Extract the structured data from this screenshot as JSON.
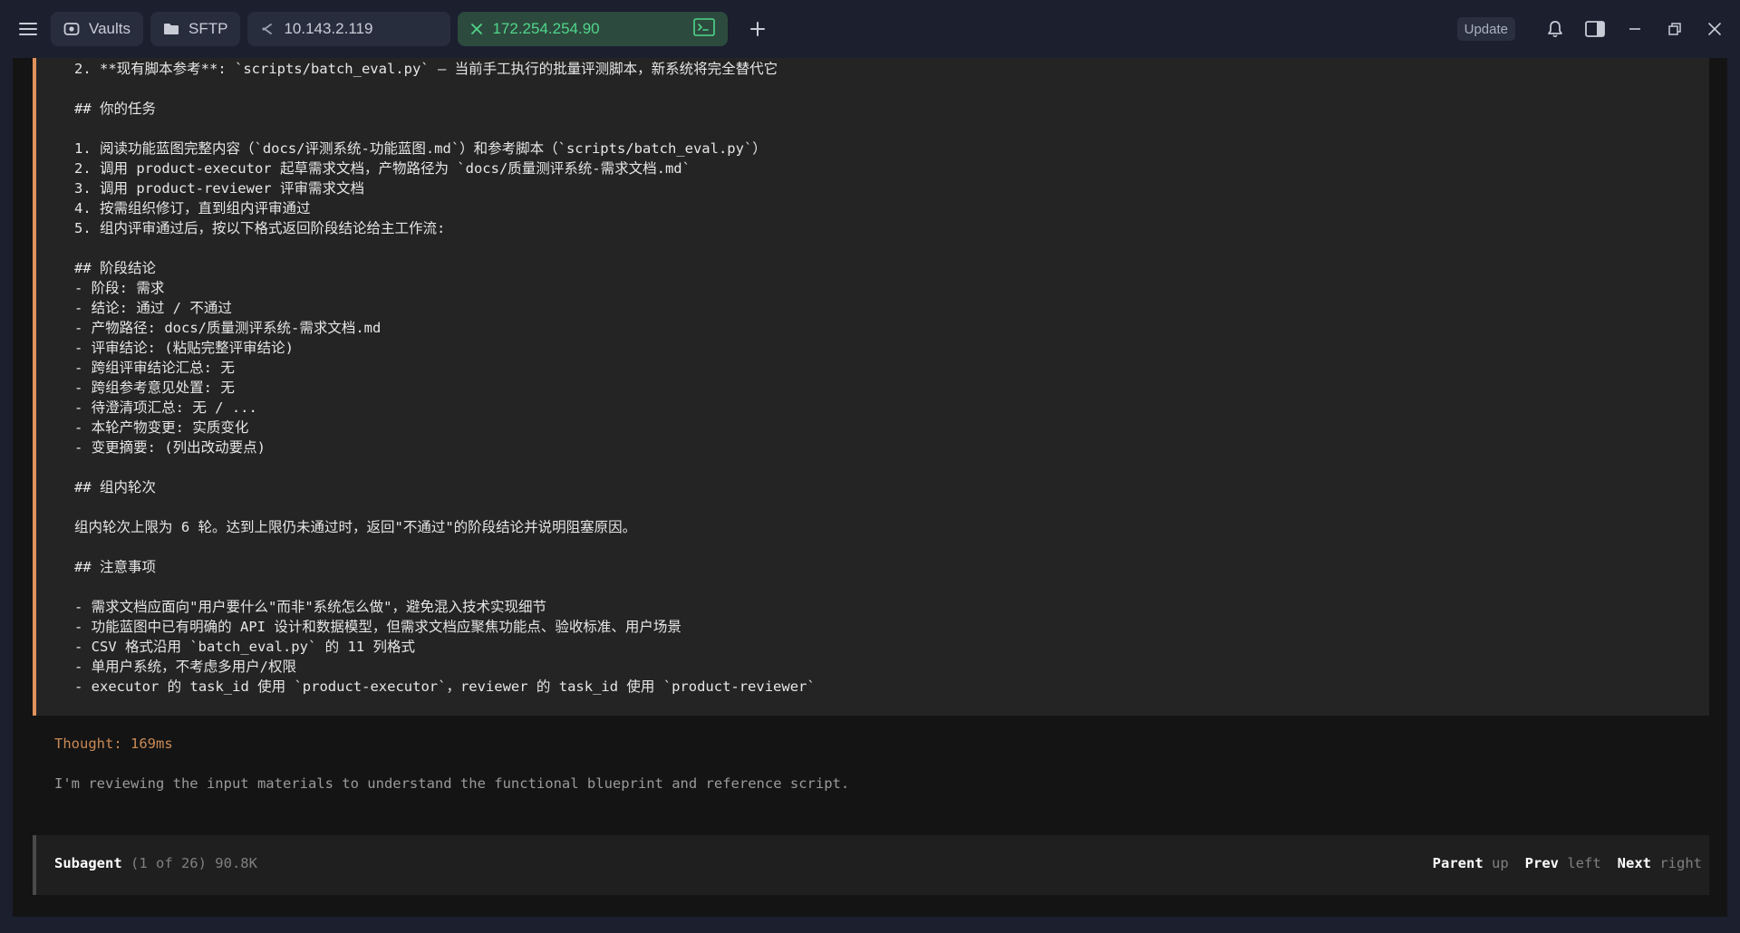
{
  "tabs": {
    "vaults_label": "Vaults",
    "sftp_label": "SFTP",
    "host_label": "10.143.2.119",
    "active_label": "172.254.254.90"
  },
  "toolbar": {
    "update_label": "Update"
  },
  "colors": {
    "accent_green": "#4fd68a",
    "quote_border": "#e0915a",
    "thought": "#c98a55"
  },
  "terminal": {
    "lines": [
      "2. **现有脚本参考**: `scripts/batch_eval.py` — 当前手工执行的批量评测脚本，新系统将完全替代它",
      "",
      "## 你的任务",
      "",
      "1. 阅读功能蓝图完整内容（`docs/评测系统-功能蓝图.md`）和参考脚本（`scripts/batch_eval.py`）",
      "2. 调用 product-executor 起草需求文档，产物路径为 `docs/质量测评系统-需求文档.md`",
      "3. 调用 product-reviewer 评审需求文档",
      "4. 按需组织修订，直到组内评审通过",
      "5. 组内评审通过后，按以下格式返回阶段结论给主工作流:",
      "",
      "## 阶段结论",
      "- 阶段: 需求",
      "- 结论: 通过 / 不通过",
      "- 产物路径: docs/质量测评系统-需求文档.md",
      "- 评审结论: (粘贴完整评审结论)",
      "- 跨组评审结论汇总: 无",
      "- 跨组参考意见处置: 无",
      "- 待澄清项汇总: 无 / ...",
      "- 本轮产物变更: 实质变化",
      "- 变更摘要: (列出改动要点)",
      "",
      "## 组内轮次",
      "",
      "组内轮次上限为 6 轮。达到上限仍未通过时，返回\"不通过\"的阶段结论并说明阻塞原因。",
      "",
      "## 注意事项",
      "",
      "- 需求文档应面向\"用户要什么\"而非\"系统怎么做\"，避免混入技术实现细节",
      "- 功能蓝图中已有明确的 API 设计和数据模型，但需求文档应聚焦功能点、验收标准、用户场景",
      "- CSV 格式沿用 `batch_eval.py` 的 11 列格式",
      "- 单用户系统，不考虑多用户/权限",
      "- executor 的 task_id 使用 `product-executor`，reviewer 的 task_id 使用 `product-reviewer`"
    ],
    "thought_label": "Thought: 169ms",
    "thought_text": "I'm reviewing the input materials to understand the functional blueprint and reference script.",
    "subagent": {
      "title": "Subagent",
      "info": " (1 of 26) 90.8K",
      "parent_key": "Parent",
      "parent_hint": " up",
      "prev_key": "Prev",
      "prev_hint": " left",
      "next_key": "Next",
      "next_hint": " right"
    }
  }
}
